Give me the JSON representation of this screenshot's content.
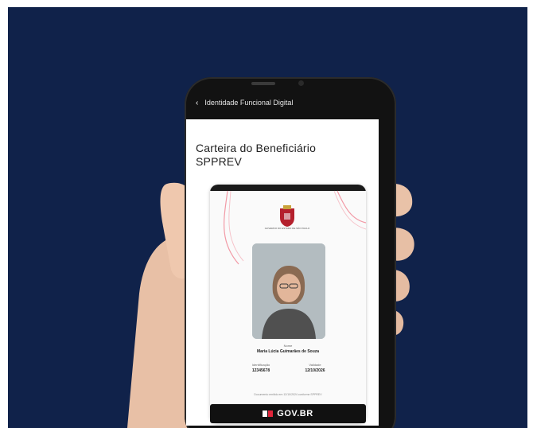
{
  "app": {
    "topbar_title": "Identidade Funcional Digital",
    "back_icon": "arrow-left-icon"
  },
  "screen": {
    "title": "Carteira do Beneficiário SPPREV"
  },
  "card": {
    "crest_icon": "coat-of-arms-icon",
    "crest_text": "GOVERNO DO ESTADO DE SÃO PAULO",
    "name_label": "Nome",
    "name_value": "Maria Lúcia Guimarães de Souza",
    "id_label": "Identificação",
    "id_value": "12345678",
    "birth_label": "Validade",
    "birth_value": "12/10/2026",
    "footnote": "Documento emitido em 12/10/2024 conforme SPPREV"
  },
  "footer": {
    "gov_label": "GOV.BR"
  },
  "colors": {
    "background": "#10224a",
    "accent_red": "#e0253a"
  }
}
